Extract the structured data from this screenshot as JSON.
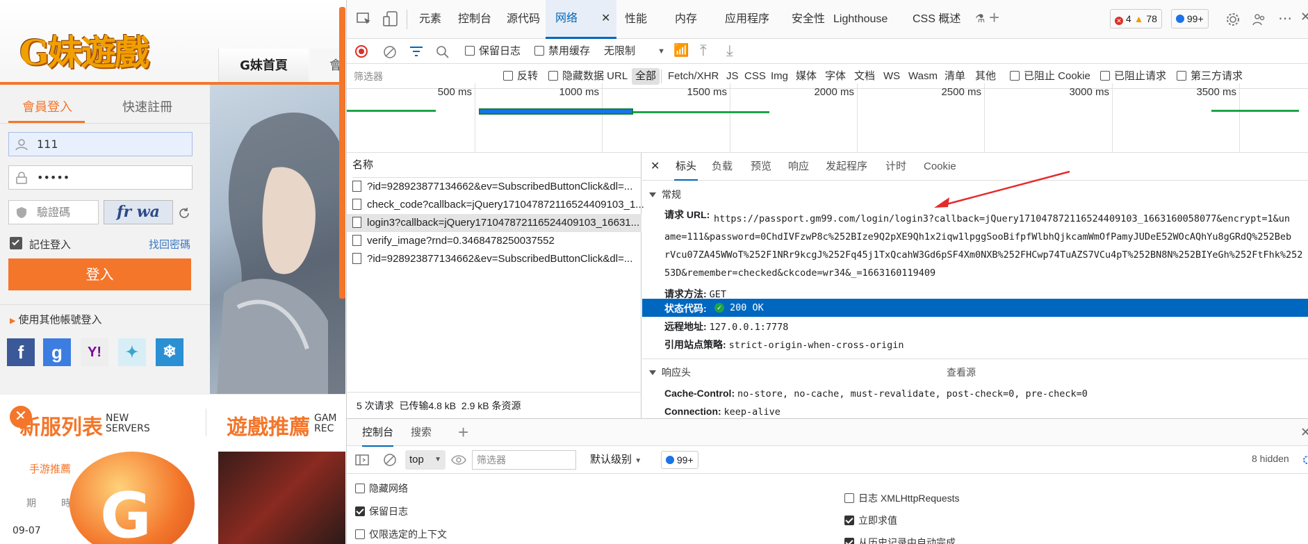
{
  "website": {
    "logo": "G妹遊戲",
    "nav_tab_active": "G妹首頁",
    "nav_tab_partial": "會",
    "login_tabs": [
      "會員登入",
      "快速註冊"
    ],
    "username_value": "111",
    "password_value": "•••••",
    "captcha_placeholder": "驗證碼",
    "captcha_image_text": "fr wa",
    "remember_label": "記住登入",
    "forgot_link": "找回密碼",
    "login_button": "登入",
    "other_login": "使用其他帳號登入",
    "social_icons": [
      "facebook-icon",
      "google-icon",
      "yahoo-icon",
      "bird-icon",
      "snowflake-icon"
    ],
    "section_title_1": "新服列表",
    "section_sub_1a": "NEW",
    "section_sub_1b": "SERVERS",
    "section_title_2": "遊戲推薦",
    "section_sub_2a": "GAM",
    "section_sub_2b": "REC",
    "mobile_games_tab": "手游推薦",
    "weekday_1": "期",
    "weekday_2": "時",
    "date": "09-07",
    "colors": {
      "accent": "#f3762b"
    }
  },
  "devtools": {
    "tabs": [
      "元素",
      "控制台",
      "源代码",
      "网络",
      "性能",
      "内存",
      "应用程序",
      "安全性",
      "Lighthouse",
      "CSS 概述"
    ],
    "active_tab": "网络",
    "errors": "4",
    "warnings": "78",
    "messages": "99+",
    "toolbar": {
      "preserve_log": "保留日志",
      "disable_cache": "禁用缓存",
      "throttling": "无限制"
    },
    "filter": {
      "placeholder": "筛选器",
      "invert": "反转",
      "hide_data_url": "隐藏数据 URL",
      "all": "全部",
      "types": [
        "Fetch/XHR",
        "JS",
        "CSS",
        "Img",
        "媒体",
        "字体",
        "文档",
        "WS",
        "Wasm",
        "清单",
        "其他"
      ],
      "blocked_cookies": "已阻止 Cookie",
      "blocked_requests": "已阻止请求",
      "third_party": "第三方请求"
    },
    "timeline_ticks": [
      "500 ms",
      "1000 ms",
      "1500 ms",
      "2000 ms",
      "2500 ms",
      "3000 ms",
      "3500 ms"
    ],
    "name_header": "名称",
    "requests": [
      "?id=928923877134662&ev=SubscribedButtonClick&dl=...",
      "check_code?callback=jQuery171047872116524409103_1...",
      "login3?callback=jQuery171047872116524409103_16631...",
      "verify_image?rnd=0.3468478250037552",
      "?id=928923877134662&ev=SubscribedButtonClick&dl=..."
    ],
    "selected_request": 2,
    "summary": "5 次请求  已传输4.8 kB  2.9 kB 条资源",
    "detail_tabs": [
      "标头",
      "负载",
      "预览",
      "响应",
      "发起程序",
      "计时",
      "Cookie"
    ],
    "general_label": "常规",
    "request_url_label": "请求 URL:",
    "request_url_lines": [
      "https://passport.gm99.com/login/login3?callback=jQuery171047872116524409103_1663160058077&encrypt=1&un",
      "ame=111&password=0ChdIVFzwP8c%252BIze9Q2pXE9Qh1x2iqw1lpggSooBifpfWlbhQjkcamWmOfPamyJUDeE52WOcAQhYu8gGRdQ%252Beb",
      "rVcu07ZA45WWoT%252F1NRr9kcgJ%252Fq45j1TxQcahW3Gd6pSF4Xm0NXB%252FHCwp74TuAZS7VCu4pT%252BN8N%252BIYeGh%252FtFhk%252",
      "53D&remember=checked&ckcode=wr34&_=1663160119409"
    ],
    "request_method_label": "请求方法:",
    "request_method": "GET",
    "status_label": "状态代码:",
    "status": "200 OK",
    "remote_label": "远程地址:",
    "remote": "127.0.0.1:7778",
    "referrer_label": "引用站点策略:",
    "referrer": "strict-origin-when-cross-origin",
    "response_headers_label": "响应头",
    "view_source": "查看源",
    "cache_control_label": "Cache-Control:",
    "cache_control": "no-store, no-cache, must-revalidate, post-check=0, pre-check=0",
    "connection_label": "Connection:",
    "connection": "keep-alive",
    "drawer_tabs": [
      "控制台",
      "搜索"
    ],
    "console_context": "top",
    "console_filter_placeholder": "筛选器",
    "log_level": "默认级别",
    "console_messages": "99+",
    "hidden_count": "8 hidden",
    "console_settings_left": [
      "隐藏网络",
      "保留日志",
      "仅限选定的上下文"
    ],
    "console_settings_left_checked": [
      false,
      true,
      false
    ],
    "console_settings_right": [
      "日志 XMLHttpRequests",
      "立即求值",
      "从历史记录中自动完成"
    ],
    "console_settings_right_checked": [
      false,
      true,
      true
    ],
    "colors": {
      "active_blue": "#0067b8",
      "selection": "#0067c0",
      "waterfall_green": "#1ea446"
    }
  }
}
